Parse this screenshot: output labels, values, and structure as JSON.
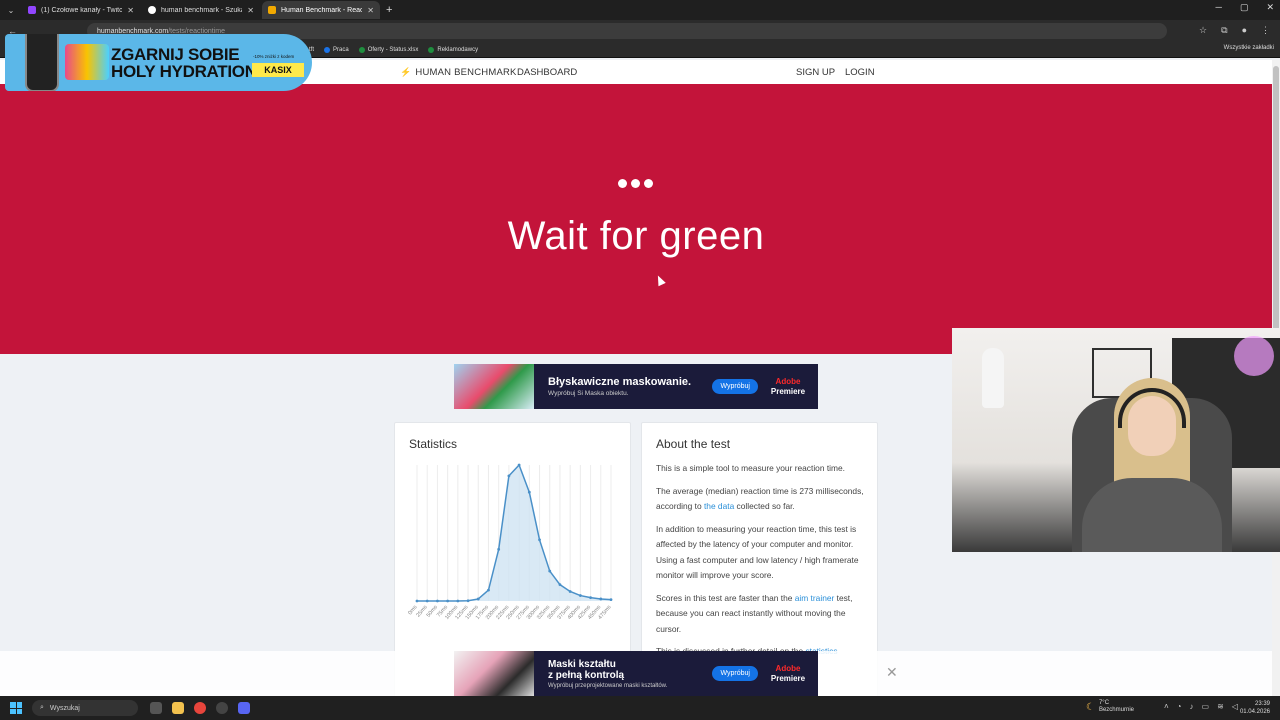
{
  "browser": {
    "tabs": [
      {
        "label": "(1) Czołowe kanały - Twitch",
        "color": "#9146ff",
        "active": false
      },
      {
        "label": "human benchmark - Szukaj w G",
        "color": "#ffffff",
        "active": false
      },
      {
        "label": "Human Benchmark - Reaction T",
        "color": "#f2a900",
        "active": true
      }
    ],
    "new_tab": "+",
    "url_host": "humanbenchmark.com",
    "url_path": "/tests/reactiontime",
    "bookmarks": [
      {
        "label": "tft",
        "color": "#f2b84b"
      },
      {
        "label": "Praca",
        "color": "#1a73e8"
      },
      {
        "label": "Oferty - Status.xlsx",
        "color": "#1e8e3e"
      },
      {
        "label": "Reklamodawcy",
        "color": "#1e8e3e"
      }
    ],
    "bookmarks_all": "Wszystkie zakładki"
  },
  "promo": {
    "title_line1": "ZGARNIJ SOBIE",
    "title_line2": "HOLY HYDRATION",
    "small": "-10% zniżki z kodem",
    "code": "KASIX"
  },
  "site": {
    "brand": "HUMAN BENCHMARK",
    "dashboard": "DASHBOARD",
    "signup": "SIGN UP",
    "login": "LOGIN"
  },
  "hero": {
    "title": "Wait for green",
    "bg_color": "#c3143a"
  },
  "ad_top": {
    "headline": "Błyskawiczne maskowanie.",
    "sub": "Wypróbuj Si Maska obiektu.",
    "button": "Wypróbuj",
    "brand_line1": "Adobe",
    "brand_line2": "Premiere"
  },
  "statistics": {
    "title": "Statistics"
  },
  "chart_data": {
    "type": "area",
    "x": [
      "0ms",
      "25ms",
      "50ms",
      "75ms",
      "100ms",
      "125ms",
      "150ms",
      "175ms",
      "200ms",
      "225ms",
      "250ms",
      "275ms",
      "300ms",
      "325ms",
      "350ms",
      "375ms",
      "400ms",
      "425ms",
      "450ms",
      "475ms"
    ],
    "values": [
      0,
      0,
      0,
      0,
      0,
      0.2,
      1.5,
      8,
      38,
      92,
      100,
      80,
      45,
      22,
      12,
      7,
      4,
      2.5,
      1.5,
      1
    ],
    "xlabel": "",
    "ylabel": "",
    "grid": true,
    "color": "#4a90c8",
    "fill": "#cfe3f3"
  },
  "about": {
    "title": "About the test",
    "p1": "This is a simple tool to measure your reaction time.",
    "p2_a": "The average (median) reaction time is 273 milliseconds, according to ",
    "p2_link": "the data",
    "p2_b": " collected so far.",
    "p3": "In addition to measuring your reaction time, this test is affected by the latency of your computer and monitor. Using a fast computer and low latency / high framerate monitor will improve your score.",
    "p4_a": "Scores in this test are faster than the ",
    "p4_link": "aim trainer",
    "p4_b": " test, because you can react instantly without moving the cursor.",
    "p5_a": "This is discussed in further detail on the ",
    "p5_link": "statistics"
  },
  "ad_bottom": {
    "headline_line1": "Maski kształtu",
    "headline_line2": "z pełną kontrolą",
    "sub": "Wypróbuj przeprojektowane maski kształtów.",
    "button": "Wypróbuj",
    "brand_line1": "Adobe",
    "brand_line2": "Premiere"
  },
  "taskbar": {
    "search": "Wyszukaj",
    "weather_temp": "7°C",
    "weather_desc": "Bezchmurnie",
    "time": "23:39",
    "date": "01.04.2026"
  }
}
